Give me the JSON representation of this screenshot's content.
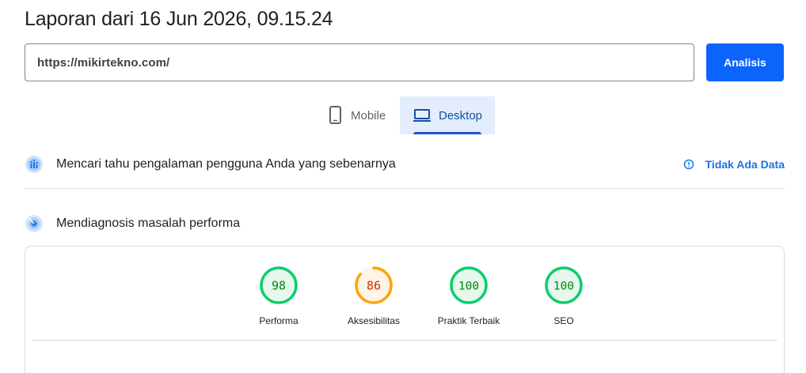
{
  "header": {
    "title": "Laporan dari 16 Jun 2026, 09.15.24"
  },
  "search": {
    "url_value": "https://mikirtekno.com/",
    "analyze_label": "Analisis"
  },
  "tabs": [
    {
      "label": "Mobile",
      "icon": "phone-icon",
      "active": false
    },
    {
      "label": "Desktop",
      "icon": "laptop-icon",
      "active": true
    }
  ],
  "field_data": {
    "heading": "Mencari tahu pengalaman pengguna Anda yang sebenarnya",
    "icon": "users-icon",
    "status_label": "Tidak Ada Data",
    "status_icon": "info-icon"
  },
  "lab_data": {
    "heading": "Mendiagnosis masalah performa",
    "icon": "gauge-target-icon"
  },
  "scores": [
    {
      "label": "Performa",
      "score": "98",
      "value": 98,
      "color": "#0cce6b",
      "fill": "#e6f8ee",
      "text_color": "#008800"
    },
    {
      "label": "Aksesibilitas",
      "score": "86",
      "value": 86,
      "color": "#ffa400",
      "fill": "#fff4e5",
      "text_color": "#c33300"
    },
    {
      "label": "Praktik Terbaik",
      "score": "100",
      "value": 100,
      "color": "#0cce6b",
      "fill": "#e6f8ee",
      "text_color": "#008800"
    },
    {
      "label": "SEO",
      "score": "100",
      "value": 100,
      "color": "#0cce6b",
      "fill": "#e6f8ee",
      "text_color": "#008800"
    }
  ]
}
